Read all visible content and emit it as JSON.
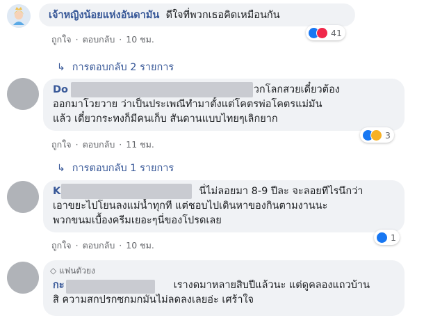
{
  "comments": [
    {
      "author": "เจ้าหญิงน้อยแห่งอันดามัน",
      "text": "ดีใจที่พวกเธอคิดเหมือนกัน",
      "reaction_count": "41",
      "reactions": [
        "like",
        "love"
      ],
      "actions": {
        "like": "ถูกใจ",
        "reply": "ตอบกลับ",
        "time": "10 ชม."
      },
      "replies_label": "การตอบกลับ 2 รายการ"
    },
    {
      "author": "Do",
      "lines": [
        "พวกโลกสวยเดี๋ยวต้อง",
        "ออกมาโวยวาย ว่าเป็นประเพณีทำมาตั้งแต่โคตรพ่อโคตรแม่มัน",
        "แล้ว เดี๋ยวกระทงก็มีคนเก็บ สันดานแบบไทยๆเลิกยาก"
      ],
      "reaction_count": "3",
      "reactions": [
        "like",
        "wow"
      ],
      "actions": {
        "like": "ถูกใจ",
        "reply": "ตอบกลับ",
        "time": "11 ชม."
      },
      "replies_label": "การตอบกลับ 1 รายการ"
    },
    {
      "author": "K",
      "lines": [
        "นี่ไม่ลอยมา 8-9 ปีละ จะลอยทีไรนึกว่า",
        "เอาขยะไปโยนลงแม่น้ำทุกที แต่ชอบไปเดินหาของกินตามงานนะ",
        "พวกขนมเบื้องครีมเยอะๆนี่ของโปรดเลย"
      ],
      "reaction_count": "1",
      "reactions": [
        "like"
      ],
      "actions": {
        "like": "ถูกใจ",
        "reply": "ตอบกลับ",
        "time": "10 ชม."
      }
    },
    {
      "badge": "แฟนตัวยง",
      "author": "กะ",
      "lines": [
        "เรางดมาหลายสิบปีแล้วนะ แต่ดูคลองแถวบ้าน",
        "สิ ความสกปรกซกมกมันไม่ลดลงเลยอ่ะ เศร้าใจ"
      ]
    }
  ],
  "colors": {
    "link": "#385898",
    "bubble": "#f0f2f5",
    "like": "#1877f2",
    "love": "#f0284a",
    "wow": "#f7b125"
  }
}
